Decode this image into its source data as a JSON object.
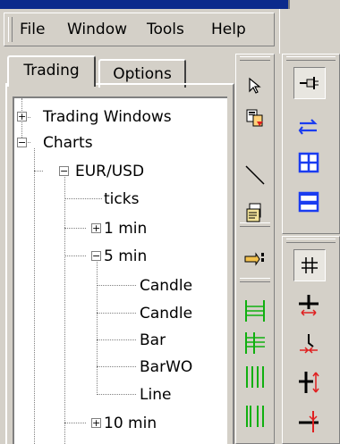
{
  "menu": {
    "items": [
      {
        "label": "File"
      },
      {
        "label": "Window"
      },
      {
        "label": "Tools"
      },
      {
        "label": "Help"
      }
    ]
  },
  "tabs": [
    {
      "label": "Trading",
      "active": true
    },
    {
      "label": "Options",
      "active": false
    }
  ],
  "tree": {
    "trading_windows": "Trading Windows",
    "charts": "Charts",
    "pair": "EUR/USD",
    "ticks": "ticks",
    "min1": "1 min",
    "min5": "5 min",
    "children_5min": [
      "Candle",
      "Candle",
      "Bar",
      "BarWO",
      "Line"
    ],
    "min10": "10 min"
  },
  "toolbar_left": {
    "icons": [
      "select-arrow-icon",
      "copy-icon",
      "line-draw-icon",
      "template-icon",
      "hand-point-icon",
      "hline-green-icon",
      "fib-green-icon",
      "vlines-green-icon",
      "vlines2-green-icon"
    ]
  },
  "toolbar_right": {
    "icons": [
      "pin-icon",
      "swap-arrows-icon",
      "tile-grid-icon",
      "tile-horizontal-icon",
      "crosshair-icon",
      "cross-hsplit-icon",
      "step-marker-icon",
      "cross-vsplit-icon",
      "cross-arrow-icon"
    ],
    "accent_blue": "#1a3cf0",
    "accent_red": "#e02020",
    "accent_green": "#10b010"
  }
}
